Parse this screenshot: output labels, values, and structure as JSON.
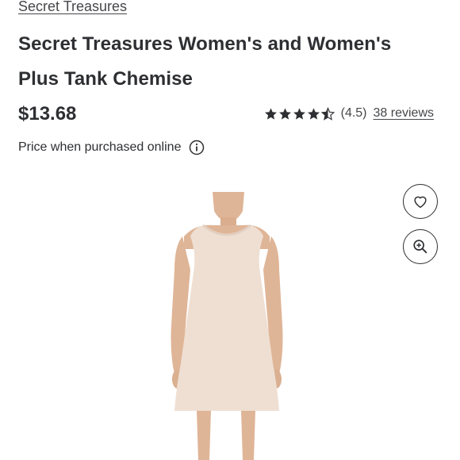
{
  "product": {
    "brand": "Secret Treasures",
    "title": "Secret Treasures Women's and Women's Plus Tank Chemise",
    "price": "$13.68",
    "price_note": "Price when purchased online",
    "rating": {
      "value": 4.5,
      "value_label": "(4.5)",
      "reviews_label": "38 reviews",
      "stars_max": 5
    }
  },
  "icons": {
    "info": "info-icon",
    "favorite": "heart-icon",
    "zoom": "zoom-in-icon",
    "star": "star-icon"
  },
  "colors": {
    "text": "#2e2f32",
    "dress": "#efdfd3",
    "skin": "#dfb597"
  }
}
